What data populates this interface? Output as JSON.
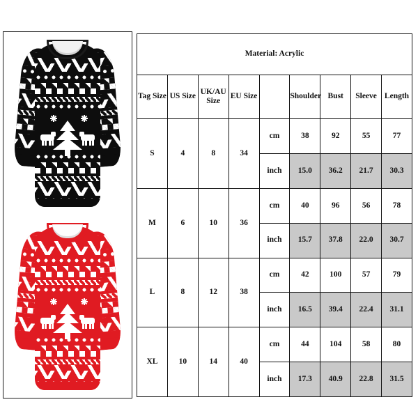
{
  "table": {
    "title": "Material: Acrylic",
    "headers": [
      "Tag Size",
      "US Size",
      "UK/AU Size",
      "EU Size",
      "",
      "Shoulder",
      "Bust",
      "Sleeve",
      "Length"
    ],
    "unit_labels": {
      "cm": "cm",
      "inch": "inch"
    },
    "rows": [
      {
        "tag": "S",
        "us": "4",
        "uk": "8",
        "eu": "34",
        "cm": {
          "shoulder": "38",
          "bust": "92",
          "sleeve": "55",
          "length": "77"
        },
        "inch": {
          "shoulder": "15.0",
          "bust": "36.2",
          "sleeve": "21.7",
          "length": "30.3"
        }
      },
      {
        "tag": "M",
        "us": "6",
        "uk": "10",
        "eu": "36",
        "cm": {
          "shoulder": "40",
          "bust": "96",
          "sleeve": "56",
          "length": "78"
        },
        "inch": {
          "shoulder": "15.7",
          "bust": "37.8",
          "sleeve": "22.0",
          "length": "30.7"
        }
      },
      {
        "tag": "L",
        "us": "8",
        "uk": "12",
        "eu": "38",
        "cm": {
          "shoulder": "42",
          "bust": "100",
          "sleeve": "57",
          "length": "79"
        },
        "inch": {
          "shoulder": "16.5",
          "bust": "39.4",
          "sleeve": "22.4",
          "length": "31.1"
        }
      },
      {
        "tag": "XL",
        "us": "10",
        "uk": "14",
        "eu": "40",
        "cm": {
          "shoulder": "44",
          "bust": "104",
          "sleeve": "58",
          "length": "80"
        },
        "inch": {
          "shoulder": "17.3",
          "bust": "40.9",
          "sleeve": "22.8",
          "length": "31.5"
        }
      }
    ],
    "highlight_color": "#c9c9c9",
    "border_color": "#111111"
  },
  "images": {
    "items": [
      {
        "name": "black-christmas-sweater-dress",
        "color_name": "Black",
        "color_hex": "#0d0d0d",
        "accent_hex": "#ffffff"
      },
      {
        "name": "red-christmas-sweater-dress",
        "color_name": "Red",
        "color_hex": "#e01b22",
        "accent_hex": "#ffffff"
      }
    ]
  }
}
